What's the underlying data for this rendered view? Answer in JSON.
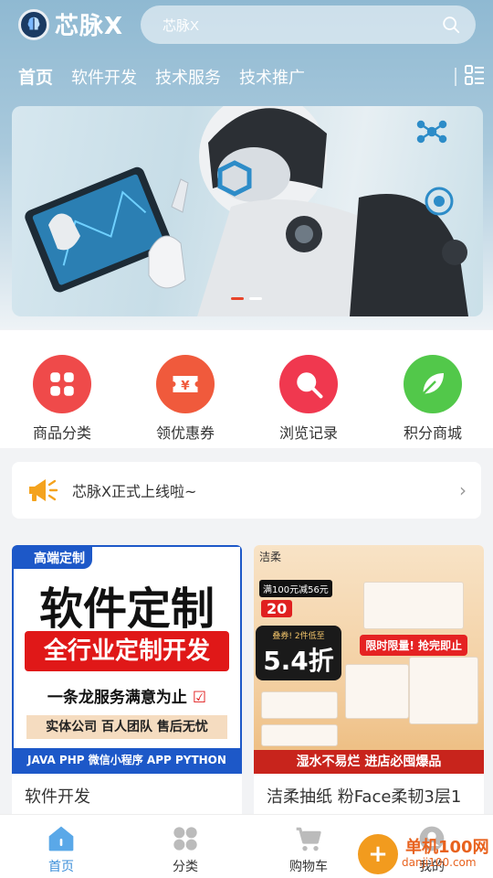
{
  "header": {
    "brand": "芯脉X",
    "search_placeholder": "芯脉X"
  },
  "nav": {
    "tabs": [
      "首页",
      "软件开发",
      "技术服务",
      "技术推广"
    ],
    "active_index": 0
  },
  "banner": {
    "slide_count": 2,
    "active_slide": 0
  },
  "quick_links": [
    {
      "label": "商品分类",
      "icon": "grid-icon",
      "color": "#ef4a4a"
    },
    {
      "label": "领优惠券",
      "icon": "coupon-icon",
      "color": "#f05a3c"
    },
    {
      "label": "浏览记录",
      "icon": "magnifier-icon",
      "color": "#f0384f"
    },
    {
      "label": "积分商城",
      "icon": "leaf-icon",
      "color": "#52c84a"
    }
  ],
  "notice": {
    "text": "芯脉X正式上线啦~"
  },
  "products": [
    {
      "title": "软件开发",
      "image_text": {
        "tag": "高端定制",
        "headline": "软件定制",
        "banner": "全行业定制开发",
        "line": "一条龙服务满意为止",
        "bar": "实体公司 百人团队 售后无忧",
        "footer": "JAVA PHP 微信小程序 APP PYTHON"
      }
    },
    {
      "title": "洁柔抽纸 粉Face柔韧3层1",
      "image_text": {
        "brand": "洁柔",
        "coupon": "满100元减56元",
        "badge": "20",
        "price_note": "叠券! 2件低至",
        "price": "5.4折",
        "limit": "限时限量! 抢完即止",
        "bottom": "湿水不易烂 进店必囤爆品"
      }
    }
  ],
  "tabbar": [
    {
      "label": "首页",
      "icon": "home-icon",
      "active": true
    },
    {
      "label": "分类",
      "icon": "category-icon",
      "active": false
    },
    {
      "label": "购物车",
      "icon": "cart-icon",
      "active": false
    },
    {
      "label": "我的",
      "icon": "user-icon",
      "active": false
    }
  ],
  "watermark": {
    "name": "单机100网",
    "url": "danji100.com"
  },
  "colors": {
    "accent": "#3d8fd9",
    "header_bg": "#8fb9d2"
  }
}
